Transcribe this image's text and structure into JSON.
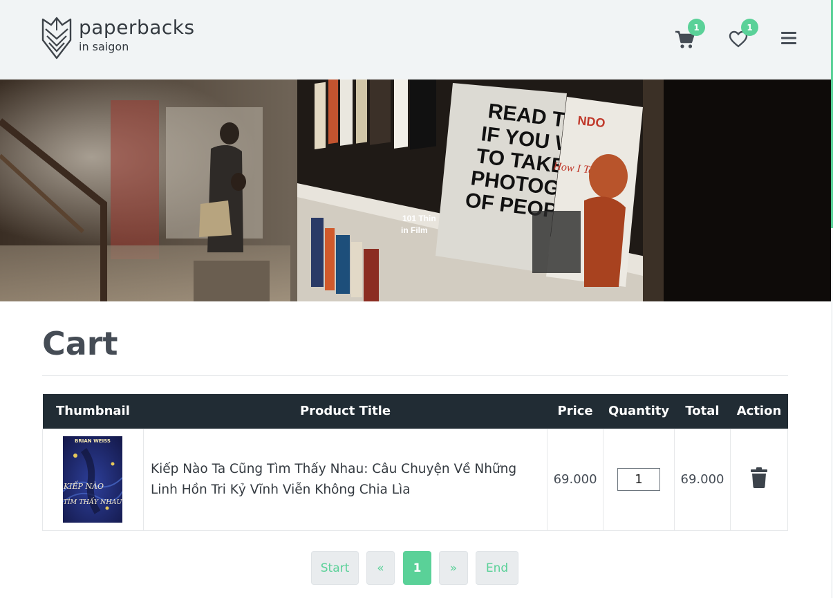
{
  "brand": {
    "name": "paperbacks",
    "tagline": "in saigon"
  },
  "header": {
    "cart_count": "1",
    "wishlist_count": "1",
    "icons": [
      "shopping-cart-icon",
      "heart-icon",
      "menu-icon"
    ]
  },
  "page": {
    "title": "Cart"
  },
  "table": {
    "headers": [
      "Thumbnail",
      "Product Title",
      "Price",
      "Quantity",
      "Total",
      "Action"
    ],
    "rows": [
      {
        "thumbnail": "book-cover",
        "title": "Kiếp Nào Ta Cũng Tìm Thấy Nhau: Câu Chuyện Về Những Linh Hồn Tri Kỷ Vĩnh Viễn Không Chia Lìa",
        "price": "69.000",
        "quantity": "1",
        "total": "69.000",
        "action_icon": "trash-icon"
      }
    ]
  },
  "book_cover": {
    "author": "BRIAN WEISS",
    "title_line1": "KIẾP NÀO",
    "title_line2": "TÌM THẤY NHAU"
  },
  "pagination": {
    "start": "Start",
    "prev": "«",
    "current": "1",
    "next": "»",
    "end": "End"
  },
  "colors": {
    "accent": "#5ad198",
    "table_header": "#212c34",
    "header_bg": "#f1f4f5"
  }
}
